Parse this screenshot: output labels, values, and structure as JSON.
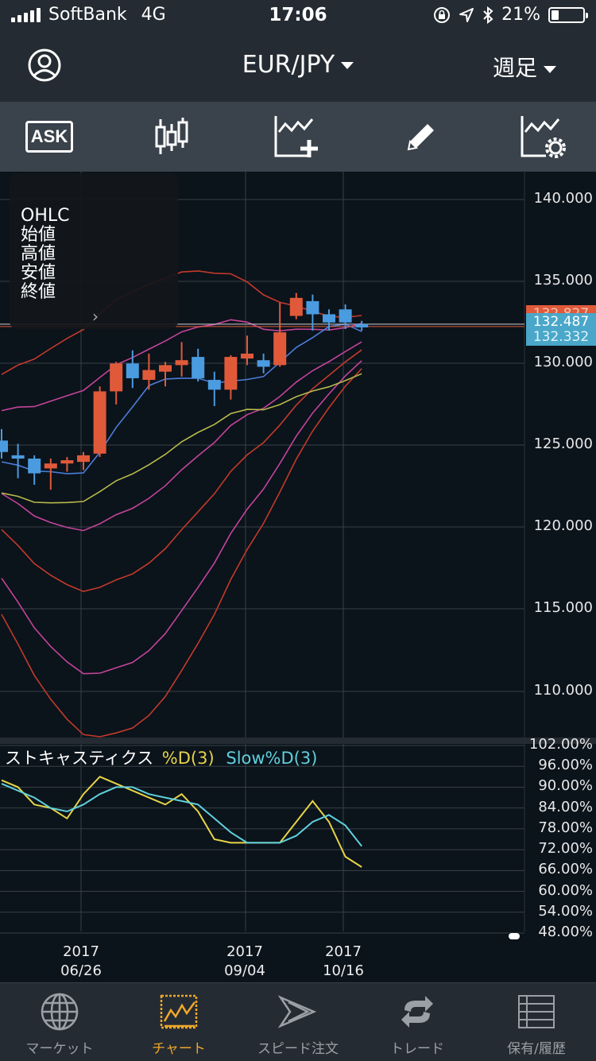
{
  "status_bar": {
    "carrier": "SoftBank",
    "network": "4G",
    "time": "17:06",
    "battery": "21%"
  },
  "header": {
    "pair": "EUR/JPY",
    "period": "週足"
  },
  "toolbar": {
    "ask_label": "ASK",
    "icons": [
      "ask-icon",
      "candlestick-icon",
      "add-indicator-icon",
      "pencil-icon",
      "chart-settings-icon"
    ]
  },
  "ohlc_panel": {
    "title": "OHLC",
    "open": "始値",
    "high": "高値",
    "low": "安値",
    "close": "終値"
  },
  "price_axis": {
    "labels": [
      "140.000",
      "135.000",
      "130.000",
      "125.000",
      "120.000",
      "115.000",
      "110.000"
    ],
    "partial_label": "132.827",
    "bid_tag": "132.487",
    "ask_tag": "132.332"
  },
  "stoch": {
    "name": "ストキャスティクス",
    "d_label": "%D(3)",
    "slow_label": "Slow%D(3)",
    "axis": [
      "102.00%",
      "96.00%",
      "90.00%",
      "84.00%",
      "78.00%",
      "72.00%",
      "66.00%",
      "60.00%",
      "54.00%",
      "48.00%"
    ],
    "d_color": "#e6d447",
    "slow_color": "#5fd0dc"
  },
  "x_axis": [
    {
      "year": "2017",
      "date": "06/26"
    },
    {
      "year": "2017",
      "date": "09/04"
    },
    {
      "year": "2017",
      "date": "10/16"
    }
  ],
  "tabs": [
    {
      "label": "マーケット",
      "icon": "globe-icon"
    },
    {
      "label": "チャート",
      "icon": "chart-icon"
    },
    {
      "label": "スピード注文",
      "icon": "speed-order-icon"
    },
    {
      "label": "トレード",
      "icon": "trade-icon"
    },
    {
      "label": "保有/履歴",
      "icon": "history-icon"
    }
  ],
  "colors": {
    "bull": "#e05a3a",
    "bear": "#4a9be0",
    "accent": "#f0a82a"
  },
  "chart_data": {
    "type": "candlestick",
    "y_range": [
      108,
      141
    ],
    "candles": [
      {
        "o": 125.3,
        "h": 126.0,
        "l": 124.2,
        "c": 124.6
      },
      {
        "o": 124.4,
        "h": 125.1,
        "l": 123.0,
        "c": 124.2
      },
      {
        "o": 124.2,
        "h": 124.4,
        "l": 122.6,
        "c": 123.3
      },
      {
        "o": 123.6,
        "h": 124.2,
        "l": 122.3,
        "c": 123.9
      },
      {
        "o": 123.9,
        "h": 124.3,
        "l": 123.4,
        "c": 124.1
      },
      {
        "o": 124.0,
        "h": 124.6,
        "l": 123.5,
        "c": 124.4
      },
      {
        "o": 124.5,
        "h": 128.6,
        "l": 124.3,
        "c": 128.3
      },
      {
        "o": 128.3,
        "h": 130.1,
        "l": 127.5,
        "c": 130.0
      },
      {
        "o": 130.0,
        "h": 130.8,
        "l": 128.5,
        "c": 129.1
      },
      {
        "o": 129.0,
        "h": 130.6,
        "l": 128.4,
        "c": 129.6
      },
      {
        "o": 129.5,
        "h": 130.1,
        "l": 128.6,
        "c": 129.9
      },
      {
        "o": 129.9,
        "h": 131.3,
        "l": 129.2,
        "c": 130.2
      },
      {
        "o": 130.4,
        "h": 130.9,
        "l": 128.9,
        "c": 129.1
      },
      {
        "o": 129.0,
        "h": 129.5,
        "l": 127.4,
        "c": 128.4
      },
      {
        "o": 128.4,
        "h": 130.5,
        "l": 127.8,
        "c": 130.4
      },
      {
        "o": 130.3,
        "h": 131.7,
        "l": 129.9,
        "c": 130.6
      },
      {
        "o": 130.2,
        "h": 130.6,
        "l": 129.4,
        "c": 129.8
      },
      {
        "o": 129.9,
        "h": 133.7,
        "l": 129.8,
        "c": 131.9
      },
      {
        "o": 132.9,
        "h": 134.3,
        "l": 132.7,
        "c": 134.0
      },
      {
        "o": 133.8,
        "h": 134.2,
        "l": 132.0,
        "c": 133.0
      },
      {
        "o": 133.0,
        "h": 133.3,
        "l": 132.0,
        "c": 132.5
      },
      {
        "o": 133.3,
        "h": 133.6,
        "l": 132.1,
        "c": 132.5
      },
      {
        "o": 132.4,
        "h": 132.6,
        "l": 132.0,
        "c": 132.2
      }
    ],
    "stoch_d": [
      92,
      90,
      85,
      84,
      81,
      88,
      93,
      91,
      89,
      87,
      85,
      88,
      83,
      75,
      74,
      74,
      74,
      74,
      80,
      86,
      80,
      70,
      67
    ],
    "stoch_slow": [
      91,
      89,
      87,
      84,
      83,
      85,
      88,
      90,
      90,
      88,
      87,
      86,
      85,
      81,
      77,
      74,
      74,
      74,
      76,
      80,
      82,
      79,
      73
    ]
  }
}
